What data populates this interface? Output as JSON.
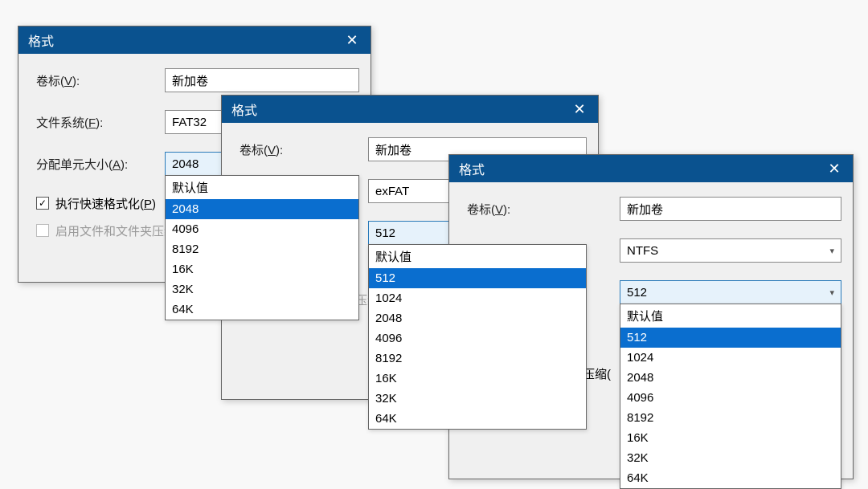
{
  "dialogs": {
    "dlg1": {
      "title": "格式",
      "volume_label_label_pre": "卷标(",
      "volume_label_key": "V",
      "label_suffix": "):",
      "volume_value": "新加卷",
      "filesystem_label_pre": "文件系统(",
      "filesystem_key": "F",
      "filesystem_value": "FAT32",
      "alloc_label_pre": "分配单元大小(",
      "alloc_key": "A",
      "alloc_value": "2048",
      "quick_format_pre": "执行快速格式化(",
      "quick_format_key": "P",
      "quick_format_suffix": ")",
      "compress_pre": "启用文件和文件夹压缩(",
      "dropdown": [
        "默认值",
        "2048",
        "4096",
        "8192",
        "16K",
        "32K",
        "64K"
      ],
      "dropdown_selected": "2048"
    },
    "dlg2": {
      "title": "格式",
      "volume_value": "新加卷",
      "filesystem_value": "exFAT",
      "alloc_value": "512",
      "dropdown": [
        "默认值",
        "512",
        "1024",
        "2048",
        "4096",
        "8192",
        "16K",
        "32K",
        "64K"
      ],
      "dropdown_selected": "512"
    },
    "dlg3": {
      "title": "格式",
      "volume_value": "新加卷",
      "filesystem_value": "NTFS",
      "alloc_value": "512",
      "dropdown": [
        "默认值",
        "512",
        "1024",
        "2048",
        "4096",
        "8192",
        "16K",
        "32K",
        "64K"
      ],
      "dropdown_selected": "512"
    }
  },
  "labels": {
    "volume_pre": "卷标(",
    "volume_key": "V",
    "suffix": "):",
    "fs_pre": "文件系统(",
    "fs_key": "F",
    "alloc_pre": "分配单元大小(",
    "alloc_key": "A",
    "quick_pre": "执行快速格式化(",
    "quick_key": "P",
    "quick_suffix": ")",
    "compress": "启用文件和文件夹压缩("
  },
  "colors": {
    "titlebar": "#0a528f",
    "highlight_bg": "#e6f2fb",
    "select_blue": "#0a6ecf"
  }
}
